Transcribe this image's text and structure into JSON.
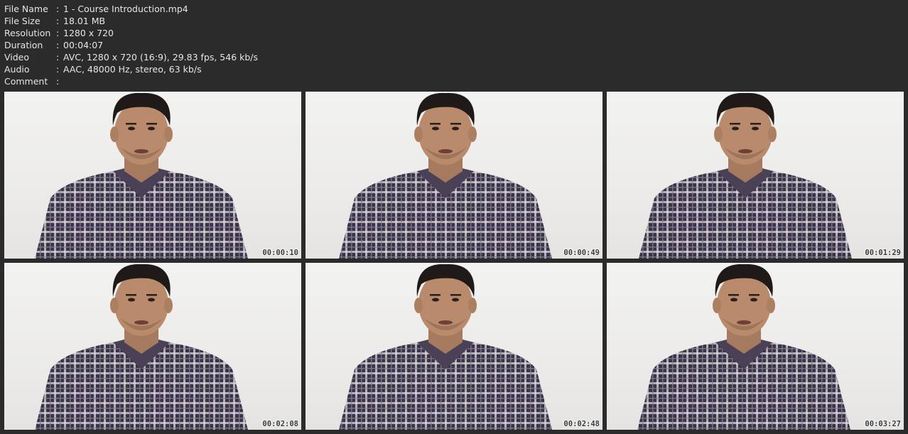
{
  "info": [
    {
      "label": "File Name",
      "value": "1 - Course Introduction.mp4"
    },
    {
      "label": "File Size",
      "value": "18.01 MB"
    },
    {
      "label": "Resolution",
      "value": "1280 x 720"
    },
    {
      "label": "Duration",
      "value": "00:04:07"
    },
    {
      "label": "Video",
      "value": "AVC, 1280 x 720 (16:9), 29.83 fps, 546 kb/s"
    },
    {
      "label": "Audio",
      "value": "AAC, 48000 Hz, stereo, 63 kb/s"
    },
    {
      "label": "Comment",
      "value": ""
    }
  ],
  "separator": ":",
  "thumbnails": [
    {
      "timestamp": "00:00:10"
    },
    {
      "timestamp": "00:00:49"
    },
    {
      "timestamp": "00:01:29"
    },
    {
      "timestamp": "00:02:08"
    },
    {
      "timestamp": "00:02:48"
    },
    {
      "timestamp": "00:03:27"
    }
  ],
  "colors": {
    "background": "#2b2b2b",
    "text": "#e6e6e6",
    "frame_wall": "#efeeec",
    "shirt": "#3b3346",
    "skin": "#b98a6c",
    "hair": "#1f1a17"
  }
}
